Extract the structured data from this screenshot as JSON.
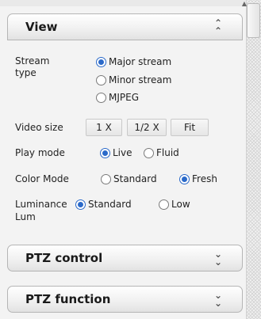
{
  "view": {
    "title": "View",
    "stream_type": {
      "label_line1": "Stream",
      "label_line2": "type",
      "options": [
        "Major stream",
        "Minor stream",
        "MJPEG"
      ],
      "selected": "Major stream"
    },
    "video_size": {
      "label": "Video size",
      "buttons": [
        "1 X",
        "1/2 X",
        "Fit"
      ]
    },
    "play_mode": {
      "label": "Play mode",
      "options": [
        "Live",
        "Fluid"
      ],
      "selected": "Live"
    },
    "color_mode": {
      "label": "Color Mode",
      "options": [
        "Standard",
        "Fresh"
      ],
      "selected": "Fresh"
    },
    "luminance": {
      "label_line1": "Luminance",
      "label_line2": "Lum",
      "options": [
        "Standard",
        "Low"
      ],
      "selected": "Standard"
    }
  },
  "ptz_control": {
    "title": "PTZ control"
  },
  "ptz_function": {
    "title": "PTZ function"
  },
  "icons": {
    "collapse": "double-chevron-up-icon",
    "expand": "double-chevron-down-icon"
  },
  "colors": {
    "radio_accent": "#2a69c9",
    "panel_border": "#b5b5b5"
  }
}
